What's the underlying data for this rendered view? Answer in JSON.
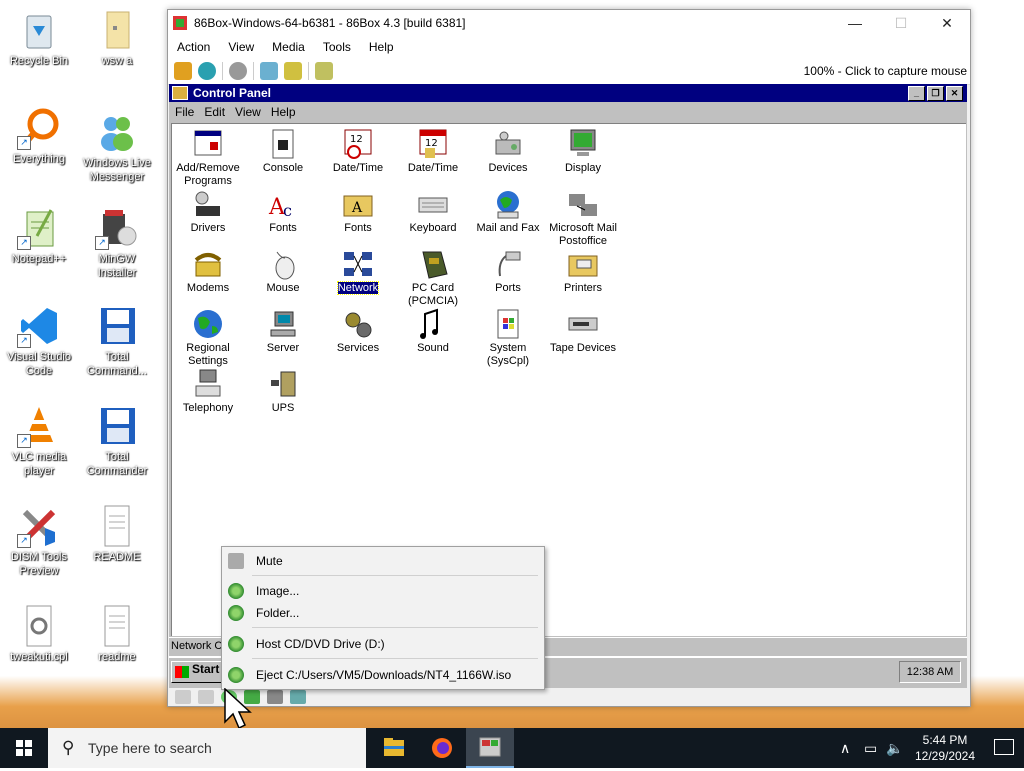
{
  "desktop": {
    "icons": [
      {
        "label": "Recycle Bin",
        "icon": "recycle-bin-icon"
      },
      {
        "label": "wsw a",
        "icon": "folder-icon"
      },
      {
        "label": "Everything",
        "icon": "search-app-icon"
      },
      {
        "label": "Windows Live Messenger",
        "icon": "messenger-icon"
      },
      {
        "label": "Notepad++",
        "icon": "notepad-icon"
      },
      {
        "label": "MinGW Installer",
        "icon": "installer-icon"
      },
      {
        "label": "Visual Studio Code",
        "icon": "vscode-icon"
      },
      {
        "label": "Total Command...",
        "icon": "floppy-icon"
      },
      {
        "label": "VLC media player",
        "icon": "vlc-icon"
      },
      {
        "label": "Total Commander",
        "icon": "floppy-icon"
      },
      {
        "label": "DISM Tools Preview",
        "icon": "tools-icon"
      },
      {
        "label": "README",
        "icon": "document-icon"
      },
      {
        "label": "tweakuti.cpl",
        "icon": "gear-document-icon"
      },
      {
        "label": "readme",
        "icon": "document-icon"
      }
    ]
  },
  "host": {
    "title": "86Box-Windows-64-b6381 - 86Box 4.3 [build 6381]",
    "menu": [
      "Action",
      "View",
      "Media",
      "Tools",
      "Help"
    ],
    "capture_hint": "100% - Click to capture mouse"
  },
  "control_panel": {
    "title": "Control Panel",
    "menu": [
      "File",
      "Edit",
      "View",
      "Help"
    ],
    "items": [
      {
        "label": "Add/Remove Programs"
      },
      {
        "label": "Console"
      },
      {
        "label": "Date/Time"
      },
      {
        "label": "Date/Time"
      },
      {
        "label": "Devices"
      },
      {
        "label": "Display"
      },
      {
        "label": "Drivers"
      },
      {
        "label": "Fonts"
      },
      {
        "label": "Fonts"
      },
      {
        "label": "Keyboard"
      },
      {
        "label": "Mail and Fax"
      },
      {
        "label": "Microsoft Mail Postoffice"
      },
      {
        "label": "Modems"
      },
      {
        "label": "Mouse"
      },
      {
        "label": "Network",
        "selected": true
      },
      {
        "label": "PC Card (PCMCIA)"
      },
      {
        "label": "Ports"
      },
      {
        "label": "Printers"
      },
      {
        "label": "Regional Settings"
      },
      {
        "label": "Server"
      },
      {
        "label": "Services"
      },
      {
        "label": "Sound"
      },
      {
        "label": "System (SysCpl)"
      },
      {
        "label": "Tape Devices"
      },
      {
        "label": "Telephony"
      },
      {
        "label": "UPS"
      }
    ],
    "status": "Network C"
  },
  "nt_taskbar": {
    "start": "Start",
    "clock": "12:38 AM"
  },
  "context_menu": {
    "items": [
      {
        "label": "Mute",
        "icon": "mute-icon"
      },
      {
        "label": "Image...",
        "icon": "cd-icon"
      },
      {
        "label": "Folder...",
        "icon": "cd-icon"
      },
      {
        "label": "Host CD/DVD Drive (D:)",
        "icon": "cd-icon"
      },
      {
        "label": "Eject C:/Users/VM5/Downloads/NT4_1166W.iso",
        "icon": "cd-icon"
      }
    ]
  },
  "taskbar": {
    "search_placeholder": "Type here to search",
    "time": "5:44 PM",
    "date": "12/29/2024"
  }
}
